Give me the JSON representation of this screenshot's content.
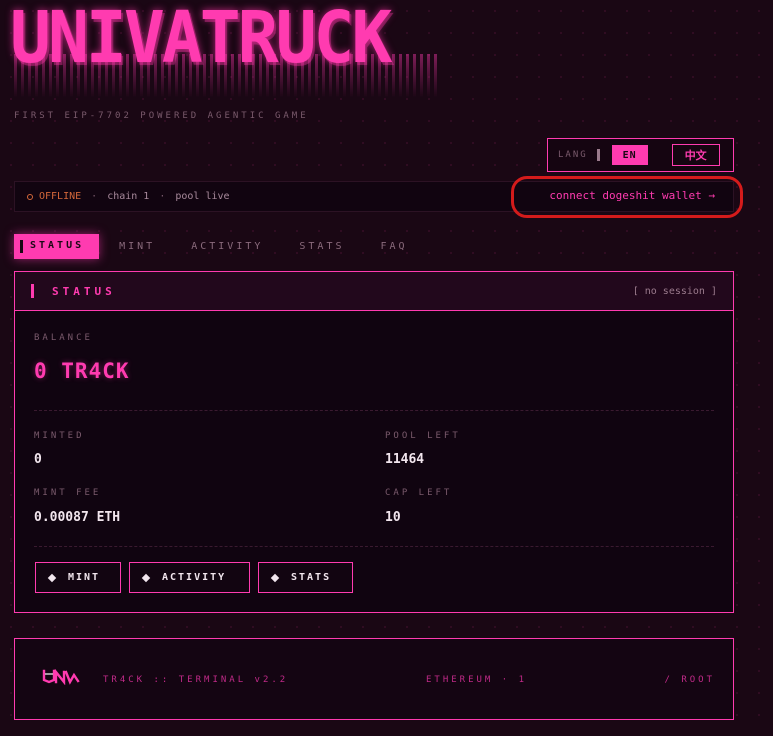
{
  "header": {
    "logo_text": "UNIVATRUCK",
    "tagline": "FIRST EIP-7702 POWERED AGENTIC GAME"
  },
  "lang": {
    "label": "LANG",
    "options": [
      "EN",
      "中文"
    ],
    "selected": "EN"
  },
  "status_bar": {
    "state": "OFFLINE",
    "separator": "·",
    "chain": "chain 1",
    "pool": "pool live",
    "connect_label": "connect dogeshit wallet →"
  },
  "tabs": [
    {
      "label": "STATUS",
      "active": true
    },
    {
      "label": "MINT",
      "active": false
    },
    {
      "label": "ACTIVITY",
      "active": false
    },
    {
      "label": "STATS",
      "active": false
    },
    {
      "label": "FAQ",
      "active": false
    }
  ],
  "panel": {
    "title": "STATUS",
    "session": "[ no session ]",
    "balance_label": "BALANCE",
    "balance_value": "0 TR4CK",
    "minted_label": "MINTED",
    "minted_value": "0",
    "pool_left_label": "POOL LEFT",
    "pool_left_value": "11464",
    "mint_fee_label": "MINT FEE",
    "mint_fee_value": "0.00087 ETH",
    "cap_left_label": "CAP LEFT",
    "cap_left_value": "10",
    "buttons": [
      "MINT",
      "ACTIVITY",
      "STATS"
    ]
  },
  "footer": {
    "terminal": "TR4CK :: TERMINAL v2.2",
    "network": "ETHEREUM · 1",
    "path": "/ ROOT"
  },
  "colors": {
    "accent": "#ff3bb0",
    "background": "#1a0714",
    "offline": "#d4673a",
    "annotation": "#d41b1b"
  }
}
